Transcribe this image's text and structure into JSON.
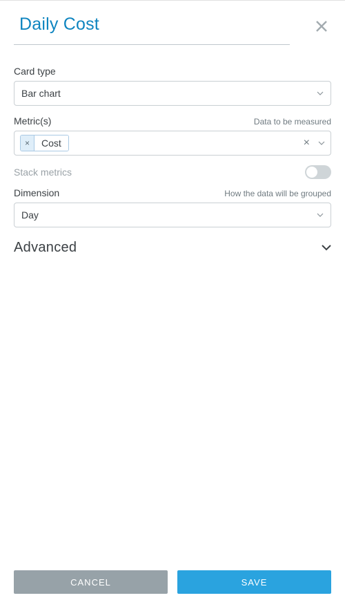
{
  "title": "Daily Cost",
  "cardType": {
    "label": "Card type",
    "value": "Bar chart"
  },
  "metrics": {
    "label": "Metric(s)",
    "helper": "Data to be measured",
    "selected": {
      "label": "Cost"
    }
  },
  "stackMetrics": {
    "label": "Stack metrics",
    "enabled": false
  },
  "dimension": {
    "label": "Dimension",
    "helper": "How the data will be grouped",
    "value": "Day"
  },
  "advanced": {
    "label": "Advanced"
  },
  "buttons": {
    "cancel": "CANCEL",
    "save": "SAVE"
  }
}
